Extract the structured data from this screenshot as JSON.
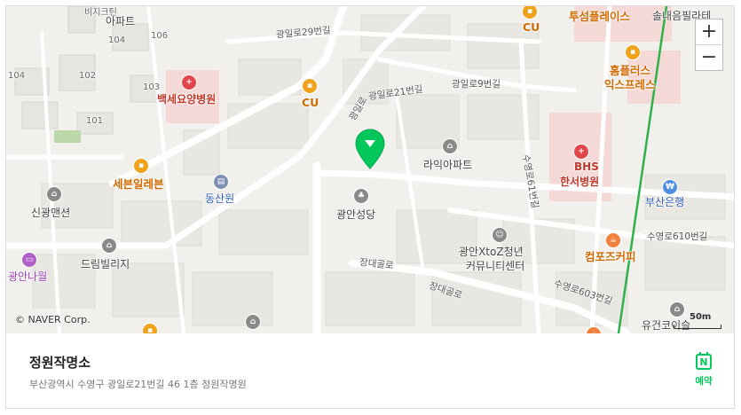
{
  "place": {
    "name": "정원작명소",
    "address": "부산광역시 수영구 광일로21번길 46 1층 정원작명원"
  },
  "actions": {
    "reserve_label": "예약",
    "reserve_icon": "naver-n-icon"
  },
  "map": {
    "copyright": "© NAVER Corp.",
    "scale_label": "50m",
    "zoom_in": "+",
    "zoom_out": "−",
    "labels": {
      "apt_top": "비지크틴",
      "apt_top2": "아파트",
      "b104": "104",
      "b106": "106",
      "b104b": "104",
      "b102": "102",
      "b103": "103",
      "b101": "101",
      "road_gwangil29": "광일로29번길",
      "road_gwangil21": "광일로21번길",
      "road_gwangil9": "광일로9번길",
      "road_gwangil_v": "광일로",
      "road_suyeong61": "수영로61번길",
      "road_jangdae1": "장대골로",
      "road_jangdae2": "장대골로",
      "road_suyeong603": "수영로603번길",
      "road_suyeong610": "수영로610번길",
      "baekse": "백세요양병원",
      "cu1": "CU",
      "cu2": "CU",
      "tuseom": "투섬플레이스",
      "homeplus1": "홈플러스",
      "homeplus2": "익스프레스",
      "sollae": "솔내음필라테",
      "raik": "라익아파트",
      "bhs1": "BHS",
      "bhs2": "한서병원",
      "sebon": "세븐일레븐",
      "dongsan": "동산원",
      "gwangan_church": "광안성당",
      "sin_mansion": "신광맨션",
      "dream": "드림빌리지",
      "gwangan_na": "광안나월",
      "youth1": "광안XtoZ청년",
      "youth2": "커뮤니티센터",
      "compose": "컴포즈커피",
      "busan_bank": "부산은행",
      "yugeon": "유건코이슬"
    }
  }
}
